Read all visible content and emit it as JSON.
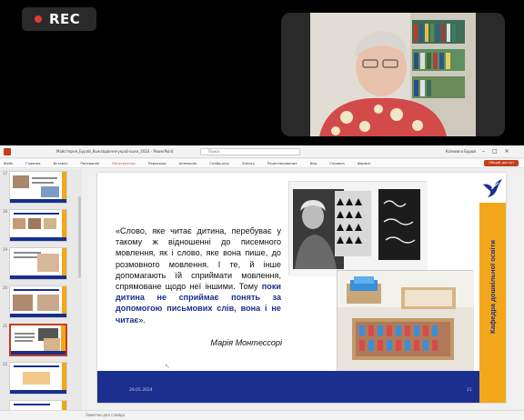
{
  "meeting": {
    "rec_label": "REC",
    "colors": {
      "rec_dot": "#e53935",
      "tile_bg": "#2a2a2a"
    }
  },
  "powerpoint": {
    "app_icon": "powerpoint-icon",
    "doc_title": "Майстерня_Бурой_Выкладання-українське_2024 - PowerPoint",
    "search_placeholder": "Поиск",
    "user_name": "Ксения и Бурой",
    "window_controls": [
      "–",
      "□",
      "×"
    ],
    "ribbon_tabs": [
      "Файл",
      "Главная",
      "Вставка",
      "Рисование",
      "Конструктор",
      "Переходы",
      "Анимация",
      "Слайд-шоу",
      "Запись",
      "Рецензирование",
      "Вид",
      "Справка",
      "Формат"
    ],
    "active_tab_index": 4,
    "share_label": "Общий доступ",
    "thumbnail_numbers": [
      "17",
      "18",
      "19",
      "20",
      "21",
      "22"
    ],
    "selected_thumbnail_index": 4,
    "notes_label": "Заметки для слайда",
    "colors": {
      "accent": "#c43e1c",
      "slide_blue": "#1b2f8f",
      "slide_orange": "#f2a71b"
    }
  },
  "slide": {
    "quote_regular": "«Слово, яке читає дитина, перебуває у такому ж відношенні до писемного мовлення, як і слово, яке вона пише, до розмовного мовлення. І те, й інше допомагають їй сприймати мовлення, спрямоване щодо неї іншими. Тому ",
    "quote_bold": "поки дитина не сприймає понять за допомогою письмових слів, вона і не читає",
    "quote_end": "».",
    "author": "Марія Монтессорі",
    "side_caption": "Кафедра дошкільної освіти",
    "date": "29.05.2024",
    "page_number": "21",
    "logo": "bird-logo-icon"
  }
}
